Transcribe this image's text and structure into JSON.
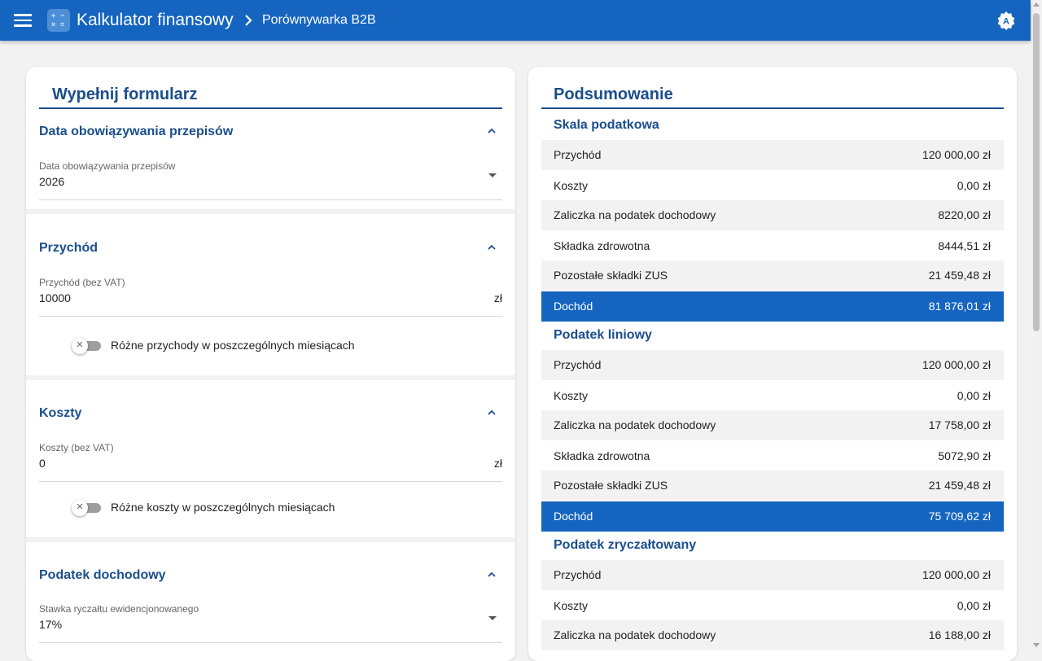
{
  "topbar": {
    "menu_icon": "hamburger-menu-icon",
    "app_title": "Kalkulator finansowy",
    "breadcrumb_separator_icon": "chevron-right-icon",
    "breadcrumb_current": "Porównywarka B2B",
    "account_icon": "account-badge-icon",
    "account_letter": "A",
    "color": "#1565c0"
  },
  "form": {
    "title": "Wypełnij formularz",
    "sections": {
      "date": {
        "header": "Data obowiązywania przepisów",
        "field_label": "Data obowiązywania przepisów",
        "field_value": "2026"
      },
      "income": {
        "header": "Przychód",
        "field_label": "Przychód (bez VAT)",
        "field_value": "10000",
        "suffix": "zł",
        "toggle_label": "Różne przychody w poszczególnych miesiącach",
        "toggle_on": false
      },
      "costs": {
        "header": "Koszty",
        "field_label": "Koszty (bez VAT)",
        "field_value": "0",
        "suffix": "zł",
        "toggle_label": "Różne koszty w poszczególnych miesiącach",
        "toggle_on": false
      },
      "tax": {
        "header": "Podatek dochodowy",
        "field_label": "Stawka ryczałtu ewidencjonowanego",
        "field_value": "17%"
      }
    }
  },
  "summary": {
    "title": "Podsumowanie",
    "groups": [
      {
        "name": "Skala podatkowa",
        "rows": [
          {
            "label": "Przychód",
            "value": "120 000,00 zł"
          },
          {
            "label": "Koszty",
            "value": "0,00 zł"
          },
          {
            "label": "Zaliczka na podatek dochodowy",
            "value": "8220,00 zł"
          },
          {
            "label": "Składka zdrowotna",
            "value": "8444,51 zł"
          },
          {
            "label": "Pozostałe składki ZUS",
            "value": "21 459,48 zł"
          },
          {
            "label": "Dochód",
            "value": "81 876,01 zł"
          }
        ]
      },
      {
        "name": "Podatek liniowy",
        "rows": [
          {
            "label": "Przychód",
            "value": "120 000,00 zł"
          },
          {
            "label": "Koszty",
            "value": "0,00 zł"
          },
          {
            "label": "Zaliczka na podatek dochodowy",
            "value": "17 758,00 zł"
          },
          {
            "label": "Składka zdrowotna",
            "value": "5072,90 zł"
          },
          {
            "label": "Pozostałe składki ZUS",
            "value": "21 459,48 zł"
          },
          {
            "label": "Dochód",
            "value": "75 709,62 zł"
          }
        ]
      },
      {
        "name": "Podatek zryczałtowany",
        "rows": [
          {
            "label": "Przychód",
            "value": "120 000,00 zł"
          },
          {
            "label": "Koszty",
            "value": "0,00 zł"
          },
          {
            "label": "Zaliczka na podatek dochodowy",
            "value": "16 188,00 zł"
          }
        ]
      }
    ]
  }
}
